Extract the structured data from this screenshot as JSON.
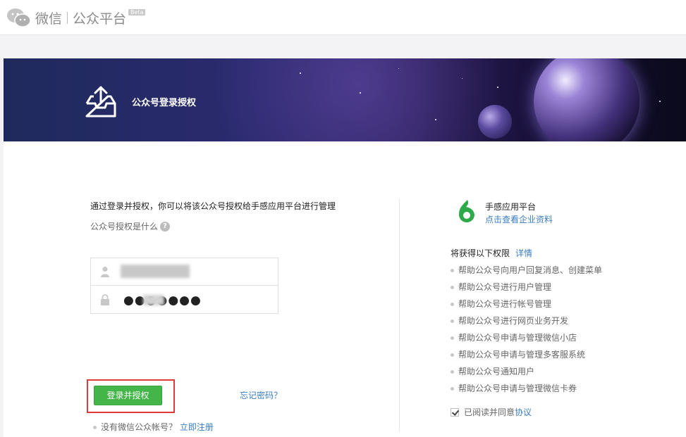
{
  "header": {
    "logo_text": "微信",
    "platform": "公众平台",
    "beta": "Beta"
  },
  "banner": {
    "title": "公众号登录授权"
  },
  "login": {
    "intro": "通过登录并授权，你可以将该公众号授权给手感应用平台进行管理",
    "what_is": "公众号授权是什么",
    "password_dots": "●●●●●●●",
    "submit_label": "登录并授权",
    "forgot_label": "忘记密码？",
    "no_account_text": "没有微信公众帐号？",
    "register_label": "立即注册"
  },
  "app": {
    "name": "手感应用平台",
    "profile_link": "点击查看企业资料"
  },
  "permissions": {
    "title": "将获得以下权限",
    "details_label": "详情",
    "items": [
      "帮助公众号向用户回复消息、创建菜单",
      "帮助公众号进行用户管理",
      "帮助公众号进行帐号管理",
      "帮助公众号进行网页业务开发",
      "帮助公众号申请与管理微信小店",
      "帮助公众号申请与管理多客服系统",
      "帮助公众号通知用户",
      "帮助公众号申请与管理微信卡券"
    ]
  },
  "agreement": {
    "text": "已阅读并同意",
    "link": "协议",
    "checked": true
  },
  "colors": {
    "accent_green": "#44b549",
    "link_blue": "#3b7dc0",
    "highlight_red": "#e0393e"
  },
  "icons": {
    "logo": "wechat-logo-icon",
    "banner": "upload-tray-icon",
    "user": "user-icon",
    "lock": "lock-icon",
    "help": "question-icon",
    "app": "app-logo-icon",
    "check": "checkbox-icon"
  }
}
